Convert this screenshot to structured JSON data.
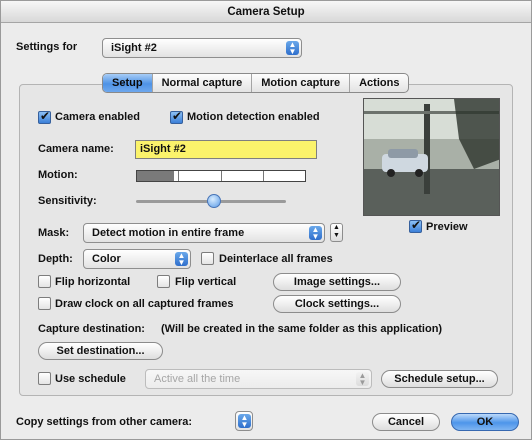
{
  "window": {
    "title": "Camera Setup"
  },
  "settings_for": {
    "label": "Settings for",
    "value": "iSight #2"
  },
  "tabs": [
    {
      "label": "Setup",
      "active": true
    },
    {
      "label": "Normal capture",
      "active": false
    },
    {
      "label": "Motion capture",
      "active": false
    },
    {
      "label": "Actions",
      "active": false
    }
  ],
  "setup": {
    "camera_enabled": {
      "label": "Camera enabled",
      "checked": true
    },
    "motion_detection": {
      "label": "Motion detection enabled",
      "checked": true
    },
    "camera_name": {
      "label": "Camera name:",
      "value": "iSight #2"
    },
    "motion": {
      "label": "Motion:",
      "level": 0.22
    },
    "sensitivity": {
      "label": "Sensitivity:",
      "value": 0.52
    },
    "mask": {
      "label": "Mask:",
      "value": "Detect motion in entire frame"
    },
    "depth": {
      "label": "Depth:",
      "value": "Color"
    },
    "deinterlace": {
      "label": "Deinterlace all frames",
      "checked": false
    },
    "flip_horizontal": {
      "label": "Flip horizontal",
      "checked": false
    },
    "flip_vertical": {
      "label": "Flip vertical",
      "checked": false
    },
    "image_settings_button": "Image settings...",
    "draw_clock": {
      "label": "Draw clock on all captured frames",
      "checked": false
    },
    "clock_settings_button": "Clock settings...",
    "capture_destination": {
      "label": "Capture destination:",
      "note": "(Will be created in the same folder as this application)",
      "button": "Set destination..."
    },
    "schedule": {
      "label": "Use schedule",
      "checked": false,
      "value": "Active all the time",
      "button": "Schedule setup..."
    },
    "preview": {
      "label": "Preview",
      "checked": true
    }
  },
  "footer": {
    "copy_label": "Copy settings from other camera:",
    "cancel": "Cancel",
    "ok": "OK"
  },
  "colors": {
    "accent": "#4d95ea",
    "name_field": "#fbf36b"
  }
}
